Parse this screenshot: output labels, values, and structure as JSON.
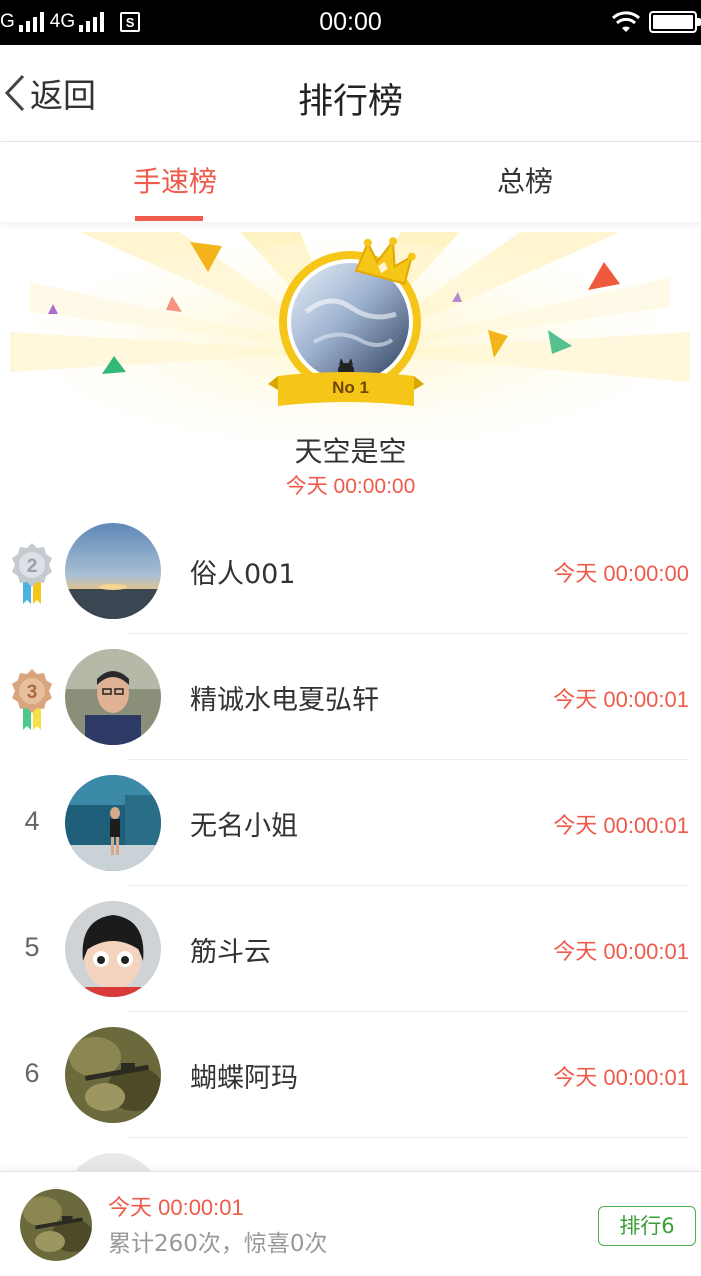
{
  "status_bar": {
    "network_left": "G",
    "network_type": "4G",
    "sim_icon": "S",
    "time": "00:00",
    "icons": [
      "signal-icon",
      "wifi-icon",
      "battery-icon"
    ]
  },
  "header": {
    "back_label": "返回",
    "title": "排行榜"
  },
  "tabs": [
    {
      "label": "手速榜",
      "active": true
    },
    {
      "label": "总榜",
      "active": false
    }
  ],
  "champion": {
    "badge": "No 1",
    "name": "天空是空",
    "time": "今天 00:00:00"
  },
  "rankings": [
    {
      "rank": "2",
      "name": "俗人001",
      "time": "今天 00:00:00"
    },
    {
      "rank": "3",
      "name": "精诚水电夏弘轩",
      "time": "今天 00:00:01"
    },
    {
      "rank": "4",
      "name": "无名小姐",
      "time": "今天 00:00:01"
    },
    {
      "rank": "5",
      "name": "筋斗云",
      "time": "今天 00:00:01"
    },
    {
      "rank": "6",
      "name": "蝴蝶阿玛",
      "time": "今天 00:00:01"
    }
  ],
  "my_record": {
    "time": "今天 00:00:01",
    "stats": "累计260次，惊喜0次",
    "rank_button": "排行6"
  },
  "colors": {
    "accent": "#ef5a4a",
    "green": "#3a9e3a",
    "gold": "#f5c518"
  }
}
